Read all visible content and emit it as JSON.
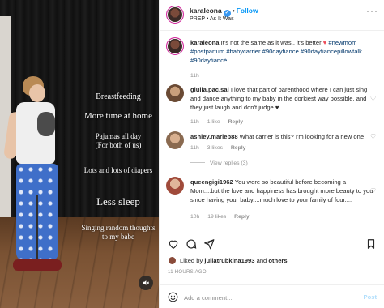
{
  "video": {
    "overlay_lines": [
      "Breastfeeding",
      "More time at home",
      "Pajamas all day\n(For both of us)",
      "Lots and lots of diapers",
      "Less sleep",
      "Singing random thoughts\nto my babe"
    ],
    "mute_icon": "speaker-muted-icon"
  },
  "header": {
    "username": "karaleona",
    "follow_label": "Follow",
    "audio_label": "PREP • As It Was",
    "more_icon": "more-options-icon"
  },
  "caption": {
    "username": "karaleona",
    "text_before_heart": "It's not the same as it was.. it's better",
    "hashtags_line": "#newmom #postpartum #babycarrier #90dayfiance #90dayfiancepillowtalk #90dayfiancé",
    "time": "11h"
  },
  "comments": [
    {
      "username": "giulia.pac.sal",
      "text": "I love that part of parenthood where I can just sing and dance anything to my baby in the dorkiest way possible, and they just laugh and don't judge ♥",
      "time": "11h",
      "likes": "1 like",
      "reply_label": "Reply"
    },
    {
      "username": "ashley.marieb88",
      "text": "What carrier is this? I'm looking for a new one",
      "time": "11h",
      "likes": "3 likes",
      "reply_label": "Reply",
      "view_replies": "View replies (3)"
    },
    {
      "username": "queengigi1962",
      "text": "You were so beautiful before becoming a Mom....but the love and happiness has brought more beauty to you since having your baby....much love to your family of four....",
      "time": "10h",
      "likes": "19 likes",
      "reply_label": "Reply"
    }
  ],
  "actions": {
    "icons": [
      "heart-icon",
      "comment-icon",
      "share-icon",
      "bookmark-icon"
    ]
  },
  "likes": {
    "prefix": "Liked by",
    "user": "juliatrubkina1993",
    "and": "and",
    "others": "others"
  },
  "timestamp": "11 HOURS AGO",
  "add_comment": {
    "placeholder": "Add a comment...",
    "post_label": "Post"
  },
  "colors": {
    "accent": "#0095f6",
    "heart": "#ed4956",
    "hashtag": "#00376b",
    "muted": "#8e8e8e"
  }
}
